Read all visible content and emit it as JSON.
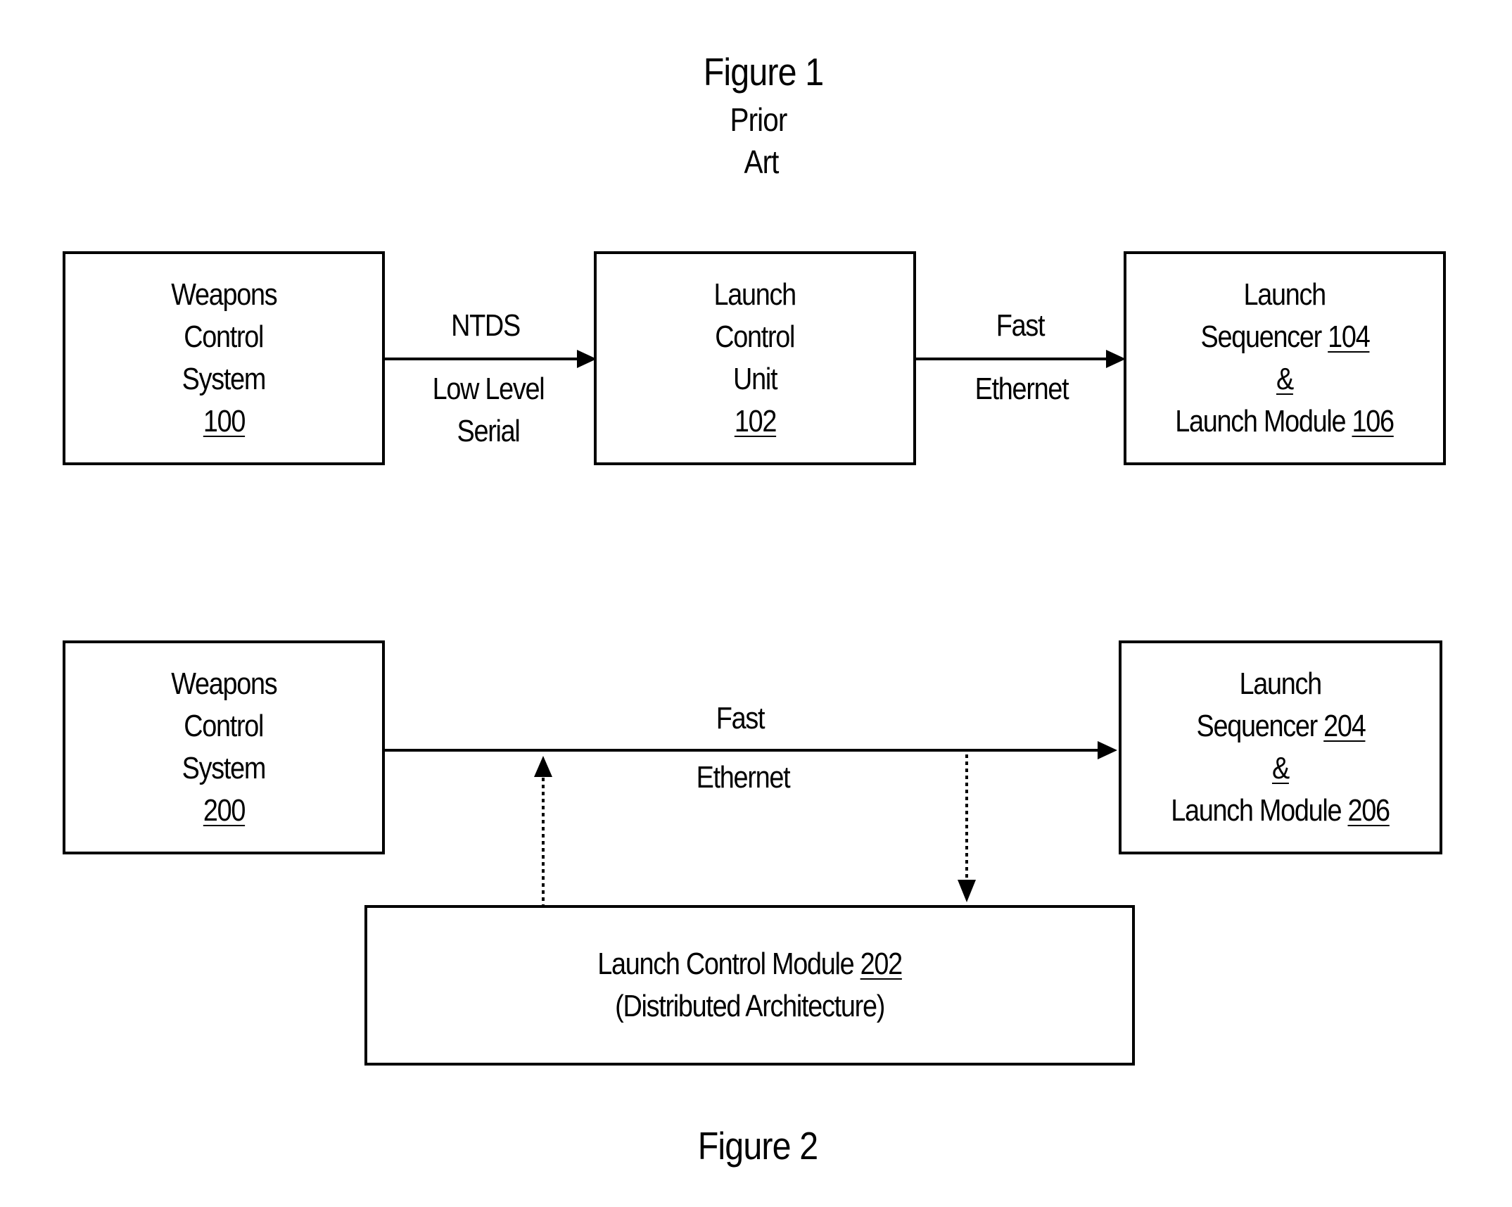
{
  "figure1": {
    "title": "Figure 1",
    "subtitle_line1": "Prior",
    "subtitle_line2": "Art",
    "nodes": [
      {
        "id": "wcs100",
        "lines": [
          "Weapons",
          "Control",
          "System"
        ],
        "ref": "100"
      },
      {
        "id": "lcu102",
        "lines": [
          "Launch",
          "Control",
          "Unit"
        ],
        "ref": "102"
      },
      {
        "id": "ls104",
        "line1": "Launch",
        "line2_text": "Sequencer ",
        "line2_ref": "104",
        "line3_ref": "&",
        "line4_text": "Launch Module ",
        "line4_ref": "106"
      }
    ],
    "edges": [
      {
        "from": "wcs100",
        "to": "lcu102",
        "label_top": "NTDS",
        "label_bottom_1": "Low Level",
        "label_bottom_2": "Serial"
      },
      {
        "from": "lcu102",
        "to": "ls104",
        "label_top": "Fast",
        "label_bottom": "Ethernet"
      }
    ]
  },
  "figure2": {
    "title": "Figure 2",
    "nodes": [
      {
        "id": "wcs200",
        "lines": [
          "Weapons",
          "Control",
          "System"
        ],
        "ref": "200"
      },
      {
        "id": "ls204",
        "line1": "Launch",
        "line2_text": "Sequencer ",
        "line2_ref": "204",
        "line3_ref": "&",
        "line4_text": "Launch Module ",
        "line4_ref": "206"
      },
      {
        "id": "lcm202",
        "line1_text": "Launch Control Module ",
        "line1_ref": "202",
        "line2": "(Distributed Architecture)"
      }
    ],
    "edges": [
      {
        "from": "wcs200",
        "to": "ls204",
        "label_top": "Fast",
        "label_bottom": "Ethernet",
        "style": "solid"
      },
      {
        "from": "lcm202",
        "to": "bus",
        "style": "dotted",
        "direction": "up"
      },
      {
        "from": "bus",
        "to": "lcm202",
        "style": "dotted",
        "direction": "down"
      }
    ]
  }
}
